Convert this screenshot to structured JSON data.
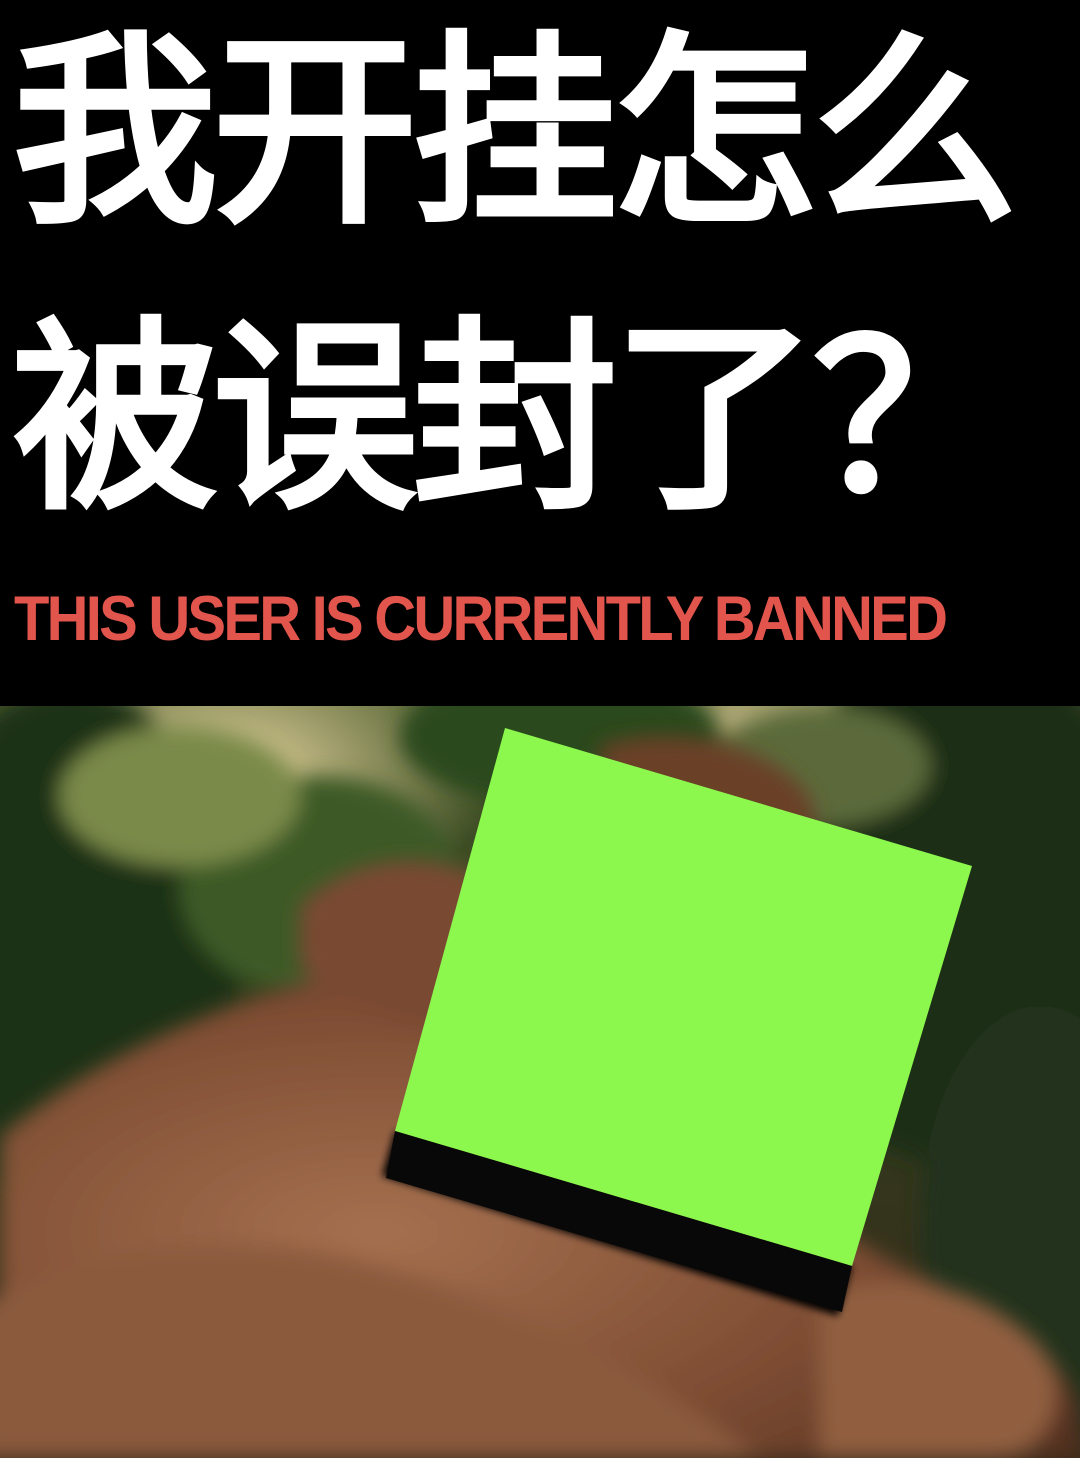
{
  "headline": {
    "line1": "我开挂怎么",
    "line2": "被误封了？"
  },
  "banner": {
    "text": "THIS USER IS CURRENTLY BANNED",
    "color": "#e2554d"
  },
  "photo": {
    "description_icon": "hand-holding-green-cube",
    "cube_color": "#8cf74d"
  }
}
